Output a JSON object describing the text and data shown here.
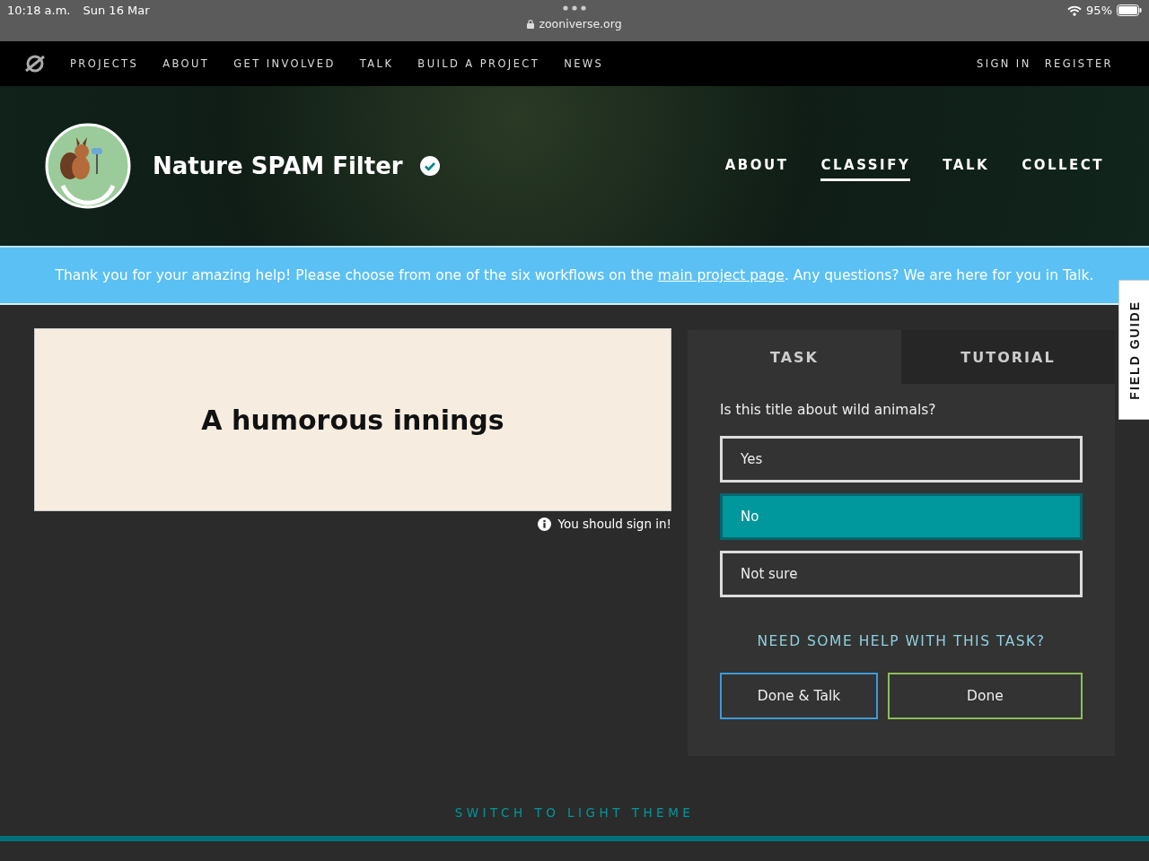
{
  "status_bar": {
    "time": "10:18 a.m.",
    "date": "Sun 16 Mar",
    "url": "zooniverse.org",
    "battery": "95%"
  },
  "nav": {
    "links": [
      "PROJECTS",
      "ABOUT",
      "GET INVOLVED",
      "TALK",
      "BUILD A PROJECT",
      "NEWS"
    ],
    "account": [
      "SIGN IN",
      "REGISTER"
    ]
  },
  "project": {
    "title": "Nature SPAM Filter",
    "verified": true,
    "tabs": [
      {
        "label": "ABOUT",
        "selected": false
      },
      {
        "label": "CLASSIFY",
        "selected": true
      },
      {
        "label": "TALK",
        "selected": false
      },
      {
        "label": "COLLECT",
        "selected": false
      }
    ]
  },
  "banner": {
    "before": "Thank you for your amazing help! Please choose from one of the six workflows on the ",
    "link": "main project page",
    "after": ". Any questions? We are here for you in Talk."
  },
  "subject": {
    "text": "A humorous innings",
    "note": "You should sign in!"
  },
  "task_panel": {
    "tabs": [
      {
        "label": "TASK",
        "selected": true
      },
      {
        "label": "TUTORIAL",
        "selected": false
      }
    ],
    "question": "Is this title about wild animals?",
    "answers": [
      {
        "label": "Yes",
        "selected": false
      },
      {
        "label": "No",
        "selected": true
      },
      {
        "label": "Not sure",
        "selected": false
      }
    ],
    "help": "NEED SOME HELP WITH THIS TASK?",
    "buttons": [
      {
        "label": "Done & Talk",
        "kind": "talk"
      },
      {
        "label": "Done",
        "kind": "done"
      }
    ]
  },
  "field_guide": "FIELD GUIDE",
  "theme_switch": "SWITCH TO LIGHT THEME"
}
